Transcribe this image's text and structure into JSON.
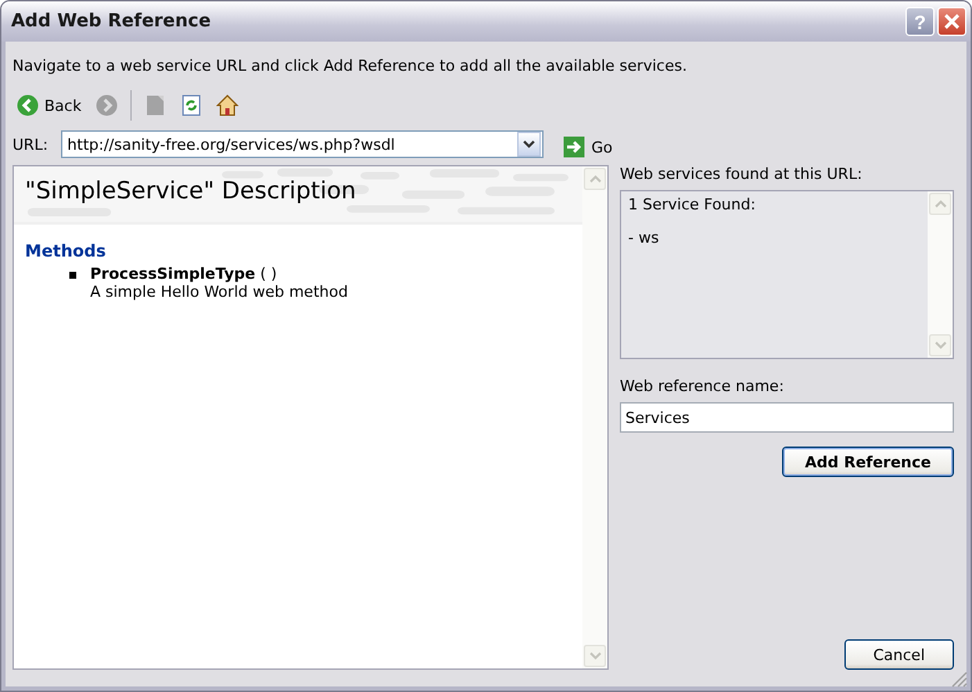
{
  "window": {
    "title": "Add Web Reference",
    "help_button": "?"
  },
  "instructions": "Navigate to a web service URL and click Add Reference to add all the available services.",
  "toolbar": [
    {
      "kind": "back",
      "label": "Back",
      "disabled": false
    },
    {
      "kind": "forward",
      "disabled": true
    },
    {
      "kind": "separator"
    },
    {
      "kind": "stop",
      "disabled": true
    },
    {
      "kind": "refresh",
      "disabled": false
    },
    {
      "kind": "home",
      "disabled": false
    }
  ],
  "url": {
    "label": "URL:",
    "value": "http://sanity-free.org/services/ws.php?wsdl",
    "go": "Go"
  },
  "description": {
    "title": "\"SimpleService\" Description",
    "section": "Methods",
    "methods": [
      {
        "name": "ProcessSimpleType",
        "signature": " ( )",
        "summary": "A simple Hello World web method"
      }
    ]
  },
  "services": {
    "label": "Web services found at this URL:",
    "lines": [
      "1 Service Found:",
      "- ws"
    ]
  },
  "reference_name": {
    "label": "Web reference name:",
    "value": "Services"
  },
  "buttons": [
    {
      "kind": "default",
      "label": "Add Reference"
    },
    {
      "kind": "normal",
      "label": "Cancel"
    }
  ]
}
